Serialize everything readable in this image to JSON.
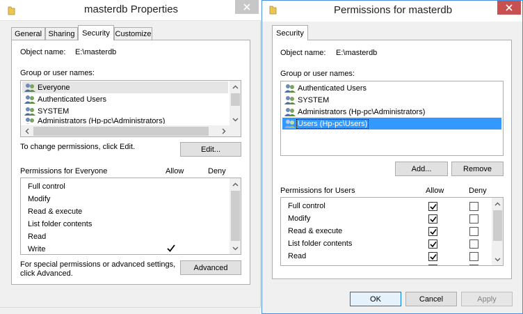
{
  "left_window": {
    "title": "masterdb Properties",
    "tabs": [
      "General",
      "Sharing",
      "Security",
      "Customize"
    ],
    "object_name_label": "Object name:",
    "object_name_value": "E:\\masterdb",
    "group_label": "Group or user names:",
    "users": [
      "Everyone",
      "Authenticated Users",
      "SYSTEM",
      "Administrators (Hp-pc\\Administrators)"
    ],
    "selected_user_index": 0,
    "change_text": "To change permissions, click Edit.",
    "edit_button": "Edit...",
    "perm_header": "Permissions for Everyone",
    "allow_header": "Allow",
    "deny_header": "Deny",
    "permissions": [
      {
        "name": "Full control",
        "allow": false,
        "deny": false
      },
      {
        "name": "Modify",
        "allow": false,
        "deny": false
      },
      {
        "name": "Read & execute",
        "allow": false,
        "deny": false
      },
      {
        "name": "List folder contents",
        "allow": false,
        "deny": false
      },
      {
        "name": "Read",
        "allow": false,
        "deny": false
      },
      {
        "name": "Write",
        "allow": true,
        "deny": false
      }
    ],
    "special_text_1": "For special permissions or advanced settings,",
    "special_text_2": "click Advanced.",
    "advanced_button": "Advanced"
  },
  "right_window": {
    "title": "Permissions for masterdb",
    "tab": "Security",
    "object_name_label": "Object name:",
    "object_name_value": "E:\\masterdb",
    "group_label": "Group or user names:",
    "users": [
      "Authenticated Users",
      "SYSTEM",
      "Administrators (Hp-pc\\Administrators)",
      "Users (Hp-pc\\Users)"
    ],
    "selected_user_index": 3,
    "add_button": "Add...",
    "remove_button": "Remove",
    "perm_header": "Permissions for Users",
    "allow_header": "Allow",
    "deny_header": "Deny",
    "permissions": [
      {
        "name": "Full control",
        "allow": true,
        "deny": false
      },
      {
        "name": "Modify",
        "allow": true,
        "deny": false
      },
      {
        "name": "Read & execute",
        "allow": true,
        "deny": false
      },
      {
        "name": "List folder contents",
        "allow": true,
        "deny": false
      },
      {
        "name": "Read",
        "allow": true,
        "deny": false
      }
    ],
    "ok_button": "OK",
    "cancel_button": "Cancel",
    "apply_button": "Apply"
  },
  "colors": {
    "selection_blue": "#3399ff",
    "close_red": "#c75050",
    "window_accent": "#4a8fde"
  },
  "icons": [
    "folder-icon",
    "close-icon",
    "users-icon",
    "checkmark-icon",
    "scroll-up-icon",
    "scroll-down-icon",
    "scroll-left-icon",
    "scroll-right-icon"
  ]
}
